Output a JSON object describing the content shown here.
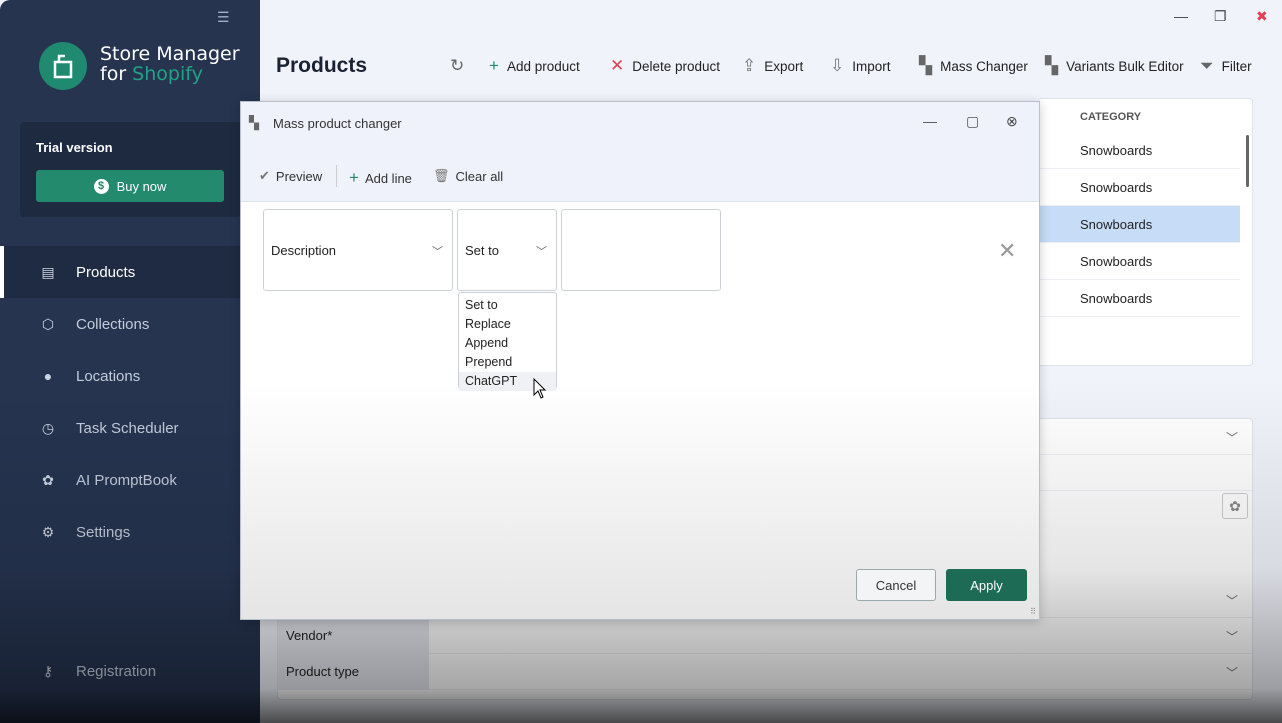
{
  "app": {
    "name_line1": "Store Manager",
    "name_line2_a": "for ",
    "name_line2_b": "Shopify",
    "trial": "Trial version",
    "buy": "Buy now"
  },
  "sidebar": {
    "items": [
      {
        "label": "Products",
        "icon": "document-icon",
        "active": true
      },
      {
        "label": "Collections",
        "icon": "cube-icon"
      },
      {
        "label": "Locations",
        "icon": "pin-icon"
      },
      {
        "label": "Task Scheduler",
        "icon": "clock-icon"
      },
      {
        "label": "AI PromptBook",
        "icon": "openai-icon"
      },
      {
        "label": "Settings",
        "icon": "gear-icon"
      }
    ],
    "registration": "Registration"
  },
  "header": {
    "title": "Products",
    "toolbar": [
      "Add product",
      "Delete product",
      "Export",
      "Import",
      "Mass Changer",
      "Variants Bulk Editor",
      "Filter"
    ]
  },
  "table": {
    "column": "CATEGORY",
    "rows": [
      "Snowboards",
      "Snowboards",
      "Snowboards",
      "Snowboards",
      "Snowboards"
    ],
    "selected_index": 2
  },
  "panel": {
    "rows": [
      "Vendor*",
      "Product type"
    ]
  },
  "dialog": {
    "title": "Mass product changer",
    "toolbar": {
      "preview": "Preview",
      "add_line": "Add line",
      "clear_all": "Clear all"
    },
    "field": "Description",
    "operation": "Set to",
    "value": "",
    "options": [
      "Set to",
      "Replace",
      "Append",
      "Prepend",
      "ChatGPT"
    ],
    "hovered_option": "ChatGPT",
    "cancel": "Cancel",
    "apply": "Apply"
  },
  "colors": {
    "sidebar": "#263450",
    "accent": "#238a6e",
    "apply": "#1e6b55",
    "selected_row": "#c6dcf7"
  }
}
